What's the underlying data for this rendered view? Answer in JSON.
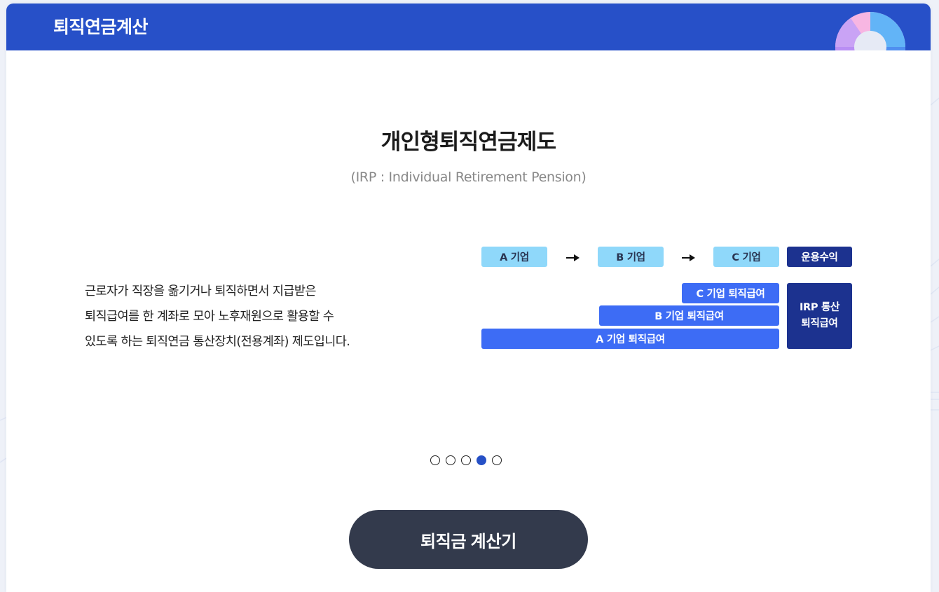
{
  "header": {
    "title": "퇴직연금계산"
  },
  "slide": {
    "title": "개인형퇴직연금제도",
    "subtitle": "(IRP : Individual Retirement Pension)",
    "description_lines": [
      "근로자가 직장을 옮기거나 퇴직하면서 지급받은",
      "퇴직급여를 한 계좌로 모아 노후재원으로 활용할 수",
      "있도록 하는 퇴직연금 통산장치(전용계좌) 제도입니다."
    ]
  },
  "diagram": {
    "companies": [
      "A 기업",
      "B 기업",
      "C 기업"
    ],
    "returns_label": "운용수익",
    "benefit_bars": [
      "C 기업 퇴직급여",
      "B 기업 퇴직급여",
      "A 기업 퇴직급여"
    ],
    "irp_label_line1": "IRP 통산",
    "irp_label_line2": "퇴직급여"
  },
  "carousel": {
    "total": 5,
    "active_index": 3
  },
  "calc_button": {
    "label": "퇴직금 계산기"
  },
  "colors": {
    "header_bg": "#2750c8",
    "light_box": "#8fd8fa",
    "dark_box": "#1c328f",
    "blue_bar": "#3d6cf5",
    "button_bg": "#333a4c",
    "active_dot": "#2650c6"
  }
}
